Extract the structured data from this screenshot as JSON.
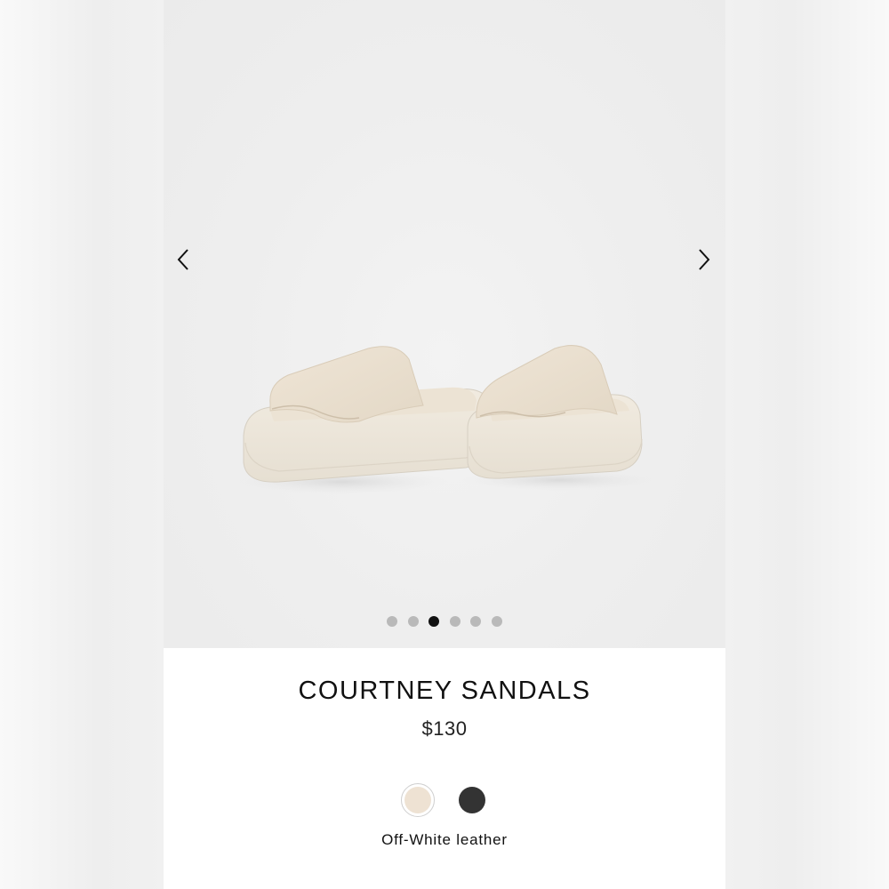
{
  "product": {
    "title": "COURTNEY SANDALS",
    "price": "$130",
    "image_icon": "sandals-product-photo"
  },
  "gallery": {
    "prev_icon": "chevron-left-icon",
    "next_icon": "chevron-right-icon",
    "dot_count": 6,
    "active_dot_index": 2
  },
  "colors": {
    "options": [
      {
        "name": "off-white",
        "hex": "#eee2d3",
        "selected": true
      },
      {
        "name": "black",
        "hex": "#333333",
        "selected": false
      }
    ],
    "selected_label": "Off-White leather"
  }
}
